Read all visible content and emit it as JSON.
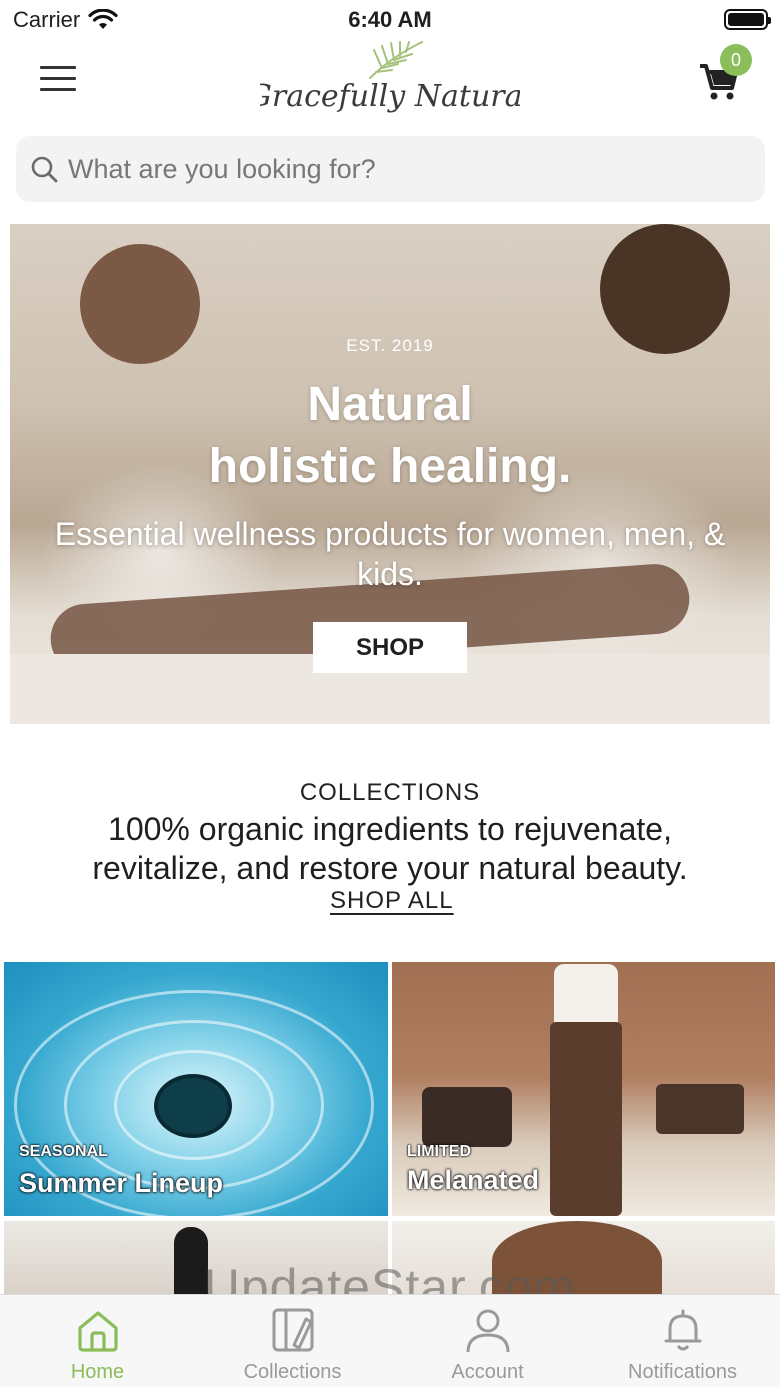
{
  "status_bar": {
    "carrier": "Carrier",
    "time": "6:40 AM"
  },
  "header": {
    "logo_text": "Gracefully Natural",
    "cart_count": "0",
    "badge_color": "#8bbd5a"
  },
  "search": {
    "placeholder": "What are you looking for?"
  },
  "hero": {
    "est": "EST. 2019",
    "title_line1": "Natural",
    "title_line2": "holistic healing.",
    "subtitle": "Essential wellness products for women, men, & kids.",
    "button_label": "SHOP"
  },
  "collections": {
    "kicker": "COLLECTIONS",
    "heading": "100% organic ingredients to rejuvenate, revitalize, and restore your natural beauty.",
    "shop_all_label": "SHOP ALL",
    "tiles": [
      {
        "kicker": "SEASONAL",
        "name": "Summer Lineup"
      },
      {
        "kicker": "LIMITED",
        "name": "Melanated"
      },
      {
        "kicker": "",
        "name": ""
      },
      {
        "kicker": "",
        "name": ""
      }
    ]
  },
  "watermark": "UpdateStar.com",
  "tabbar": {
    "accent": "#8bbd5a",
    "items": [
      {
        "label": "Home",
        "icon": "home-icon",
        "active": true
      },
      {
        "label": "Collections",
        "icon": "collections-icon",
        "active": false
      },
      {
        "label": "Account",
        "icon": "account-icon",
        "active": false
      },
      {
        "label": "Notifications",
        "icon": "bell-icon",
        "active": false
      }
    ]
  }
}
